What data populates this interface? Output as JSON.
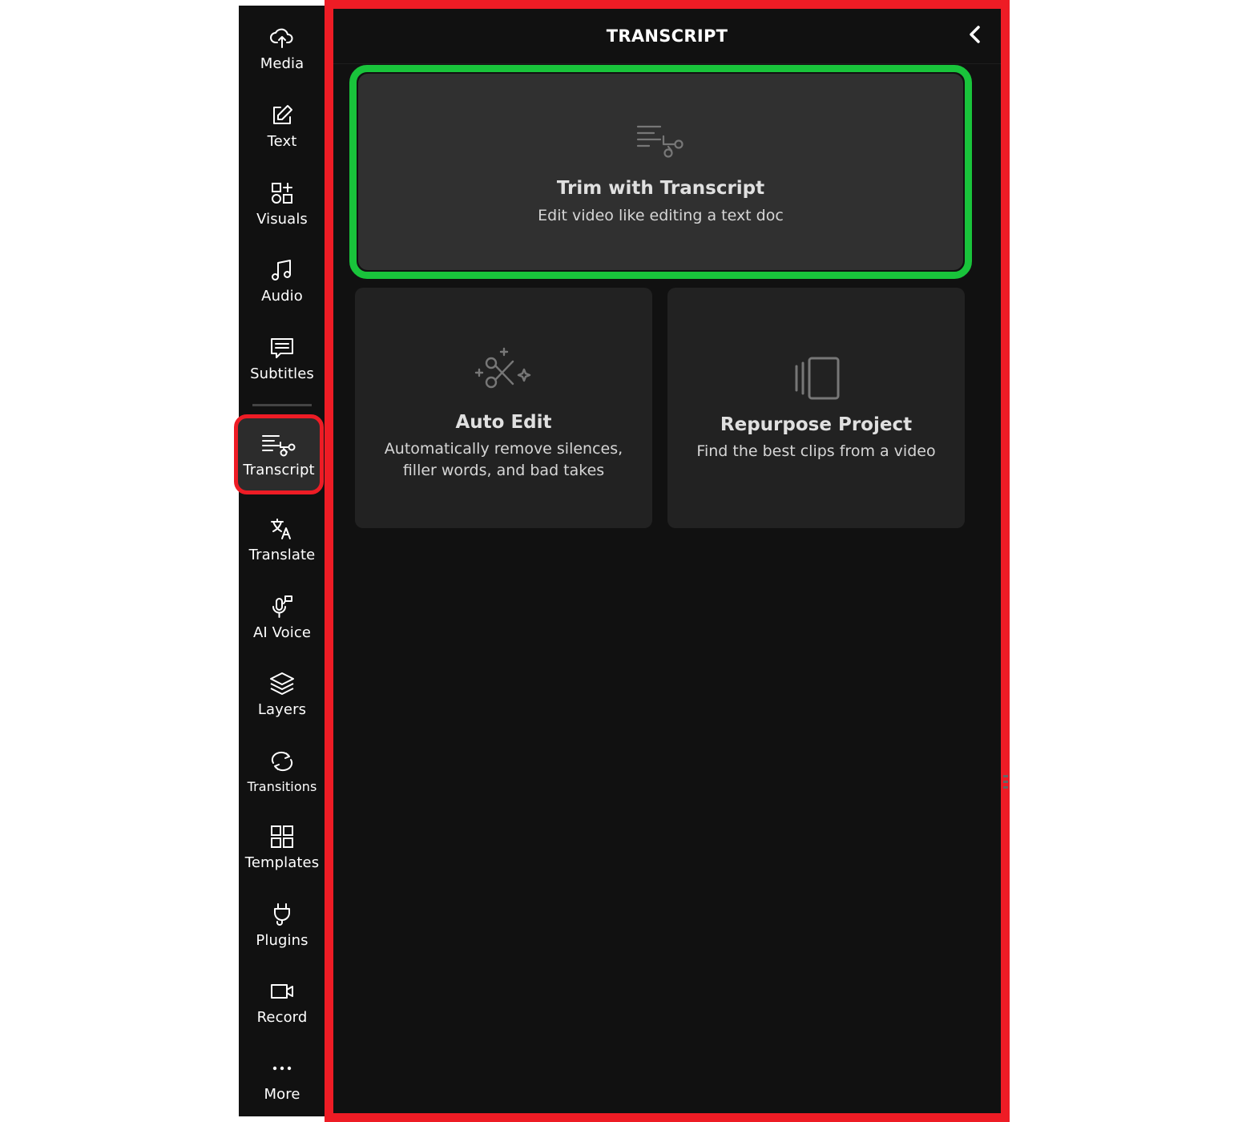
{
  "rail": {
    "items": [
      {
        "label": "Media",
        "icon": "cloud-upload-icon"
      },
      {
        "label": "Text",
        "icon": "edit-text-icon"
      },
      {
        "label": "Visuals",
        "icon": "shapes-icon"
      },
      {
        "label": "Audio",
        "icon": "music-note-icon"
      },
      {
        "label": "Subtitles",
        "icon": "subtitles-icon"
      },
      {
        "label": "Transcript",
        "icon": "transcript-scissors-icon",
        "active": true
      },
      {
        "label": "Translate",
        "icon": "translate-icon"
      },
      {
        "label": "AI Voice",
        "icon": "microphone-icon"
      },
      {
        "label": "Layers",
        "icon": "layers-icon"
      },
      {
        "label": "Transitions",
        "icon": "transitions-icon"
      },
      {
        "label": "Templates",
        "icon": "templates-grid-icon"
      },
      {
        "label": "Plugins",
        "icon": "plug-icon"
      },
      {
        "label": "Record",
        "icon": "video-camera-icon"
      },
      {
        "label": "More",
        "icon": "more-dots-icon"
      }
    ]
  },
  "panel": {
    "title": "TRANSCRIPT",
    "cards": {
      "trim": {
        "title": "Trim with Transcript",
        "subtitle": "Edit video like editing a text doc"
      },
      "auto_edit": {
        "title": "Auto Edit",
        "subtitle": "Automatically remove silences, filler words, and bad takes"
      },
      "repurpose": {
        "title": "Repurpose Project",
        "subtitle": "Find the best clips from a video"
      }
    }
  },
  "colors": {
    "highlight_red": "#ee1c25",
    "highlight_green": "#19c43b",
    "panel_bg": "#111111",
    "card_bg": "#222222"
  }
}
